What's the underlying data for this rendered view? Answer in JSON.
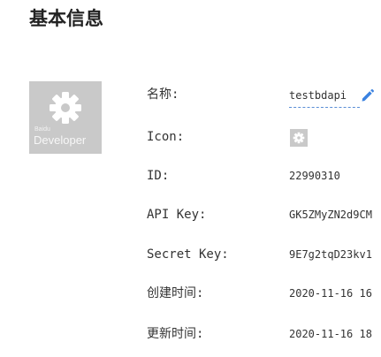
{
  "page": {
    "title": "基本信息"
  },
  "app_card": {
    "brand_small": "Baidu",
    "brand_big": "Developer",
    "icon": "gear-icon"
  },
  "fields": {
    "name": {
      "label": "名称:",
      "value": "testbdapi",
      "edit_icon": "pencil-icon"
    },
    "icon": {
      "label": "Icon:",
      "icon": "gear-icon"
    },
    "id": {
      "label": "ID:",
      "value": "22990310"
    },
    "api_key": {
      "label": "API Key:",
      "value": "GK5ZMyZN2d9CM"
    },
    "secret_key": {
      "label": "Secret Key:",
      "value": "9E7g2tqD23kv1"
    },
    "created": {
      "label": "创建时间:",
      "value": "2020-11-16 16"
    },
    "updated": {
      "label": "更新时间:",
      "value": "2020-11-16 18"
    }
  },
  "colors": {
    "accent": "#3b82e0",
    "card_bg": "#c9c9c9",
    "text": "#333333"
  }
}
